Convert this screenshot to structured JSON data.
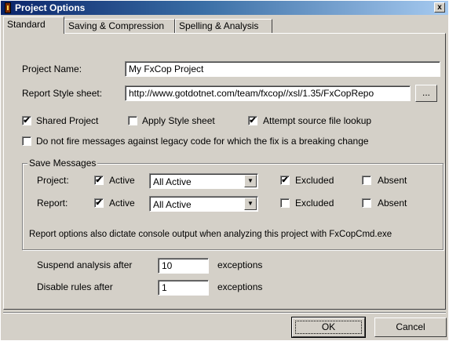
{
  "window": {
    "title": "Project Options",
    "close_label": "x"
  },
  "tabs": [
    {
      "label": "Standard"
    },
    {
      "label": "Saving & Compression"
    },
    {
      "label": "Spelling & Analysis"
    }
  ],
  "fields": {
    "project_name_label": "Project Name:",
    "project_name_value": "My FxCop Project",
    "stylesheet_label": "Report Style sheet:",
    "stylesheet_value": "http://www.gotdotnet.com/team/fxcop//xsl/1.35/FxCopRepo",
    "browse_label": "..."
  },
  "options": {
    "shared_project": {
      "label": "Shared Project",
      "checked": true
    },
    "apply_stylesheet": {
      "label": "Apply Style sheet",
      "checked": false
    },
    "attempt_lookup": {
      "label": "Attempt source file lookup",
      "checked": true
    },
    "legacy": {
      "label": "Do not fire messages against legacy code for which the fix is a breaking change",
      "checked": false
    }
  },
  "save_messages": {
    "legend": "Save Messages",
    "project": {
      "label": "Project:",
      "active_label": "Active",
      "active_checked": true,
      "select_value": "All Active",
      "excluded_label": "Excluded",
      "excluded_checked": true,
      "absent_label": "Absent",
      "absent_checked": false
    },
    "report": {
      "label": "Report:",
      "active_label": "Active",
      "active_checked": true,
      "select_value": "All Active",
      "excluded_label": "Excluded",
      "excluded_checked": false,
      "absent_label": "Absent",
      "absent_checked": false
    },
    "note": "Report options also dictate console output when analyzing this project with FxCopCmd.exe"
  },
  "limits": {
    "suspend_label": "Suspend analysis after",
    "suspend_value": "10",
    "suspend_suffix": "exceptions",
    "disable_label": "Disable rules after",
    "disable_value": "1",
    "disable_suffix": "exceptions"
  },
  "buttons": {
    "ok": "OK",
    "cancel": "Cancel"
  },
  "check_glyph": "✔"
}
